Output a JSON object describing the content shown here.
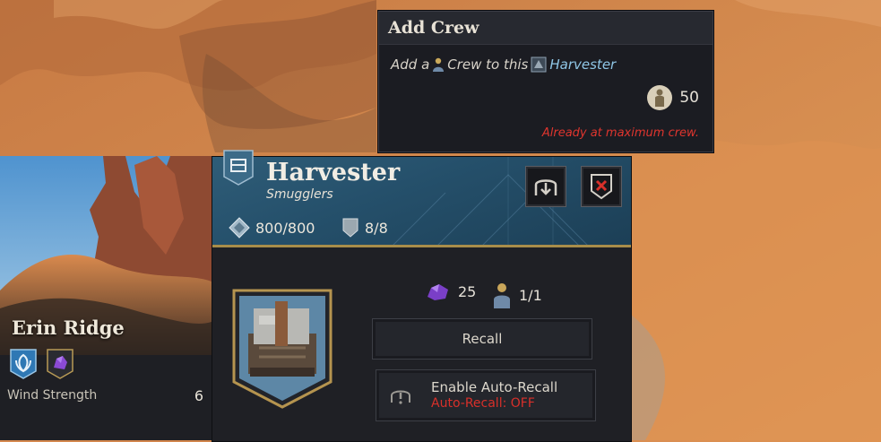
{
  "tooltip": {
    "title": "Add Crew",
    "desc_prefix": "Add a",
    "desc_middle": "Crew to this",
    "desc_link": "Harvester",
    "cost_value": "50",
    "cost_icon": "crew-cost-icon",
    "warning": "Already at maximum crew.",
    "warning_color": "#e0352e"
  },
  "location": {
    "name": "Erin Ridge",
    "badges": [
      "wind-trap-icon",
      "spice-icon"
    ],
    "stat_label": "Wind Strength",
    "stat_value": "6"
  },
  "unit": {
    "title": "Harvester",
    "faction": "Smugglers",
    "health": "800/800",
    "armor": "8/8",
    "spice": "25",
    "crew": "1/1",
    "buttons": {
      "hangar": "hangar-icon",
      "disband": "disband-icon"
    },
    "recall_label": "Recall",
    "auto_recall_label": "Enable Auto-Recall",
    "auto_recall_status": "Auto-Recall: OFF",
    "accent_color": "#a88d4a",
    "header_color": "#2a5570"
  }
}
